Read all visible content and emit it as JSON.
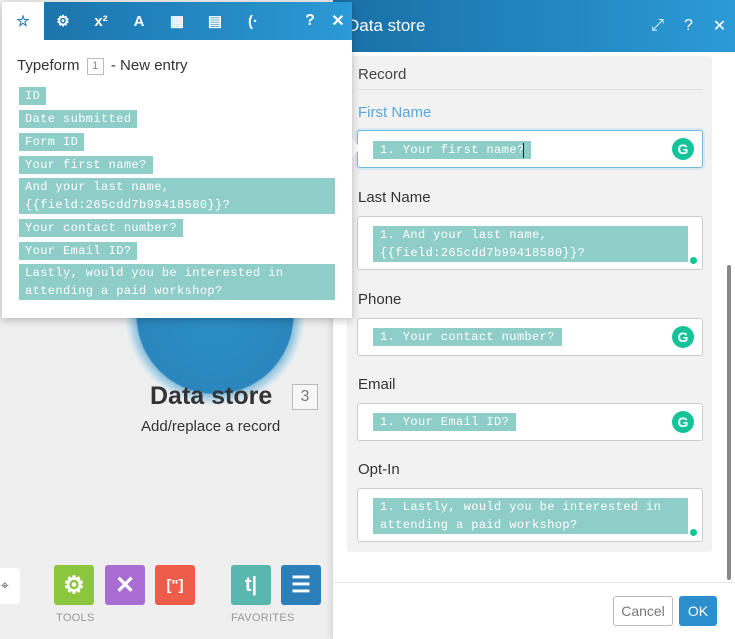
{
  "canvas": {
    "module_title": "Data store",
    "module_badge": "3",
    "module_subtitle": "Add/replace a record",
    "tools_label": "TOOLS",
    "favorites_label": "FAVORITES",
    "tools": [
      {
        "name": "gear-tool",
        "icon": "⚙"
      },
      {
        "name": "wrench-tool",
        "icon": "✕"
      },
      {
        "name": "bracket-tool",
        "icon": "[\"]"
      }
    ],
    "favorites": [
      {
        "name": "text-parser",
        "icon": "t|"
      },
      {
        "name": "data-store",
        "icon": "☰"
      }
    ],
    "colors": {
      "gear": "#8cc63f",
      "wrench": "#a86cd3",
      "bracket": "#ef5c4a",
      "text": "#58b7ae",
      "db": "#2c7fb8"
    }
  },
  "panel": {
    "title": "Data store",
    "record_label": "Record",
    "fields": [
      {
        "label": "First Name",
        "value": "1. Your first name?"
      },
      {
        "label": "Last Name",
        "value": "1. And your last name, {{field:265cdd7b99418580}}?"
      },
      {
        "label": "Phone",
        "value": "1. Your contact number?"
      },
      {
        "label": "Email",
        "value": "1. Your Email ID?"
      },
      {
        "label": "Opt-In",
        "value": "1. Lastly, would you be interested in attending a paid workshop?"
      }
    ],
    "cancel_label": "Cancel",
    "ok_label": "OK",
    "grammarly_glyph": "G"
  },
  "popup": {
    "tabs": [
      {
        "name": "tab-favorites",
        "icon": "☆"
      },
      {
        "name": "tab-settings",
        "icon": "⚙"
      },
      {
        "name": "tab-math",
        "icon": "x²"
      },
      {
        "name": "tab-text",
        "icon": "A"
      },
      {
        "name": "tab-date",
        "icon": "▦"
      },
      {
        "name": "tab-array",
        "icon": "▤"
      },
      {
        "name": "tab-custom",
        "icon": "(·"
      }
    ],
    "help_icon": "?",
    "close_icon": "✕",
    "source_name": "Typeform",
    "source_badge": "1",
    "source_suffix": "- New entry",
    "items": [
      "ID",
      "Date submitted",
      "Form ID",
      "Your first name?",
      "And your last name, {{field:265cdd7b99418580}}?",
      "Your contact number?",
      "Your Email ID?",
      "Lastly, would you be interested in attending a paid workshop?"
    ]
  },
  "header_icons": {
    "expand": "⤢",
    "help": "?",
    "close": "✕"
  }
}
